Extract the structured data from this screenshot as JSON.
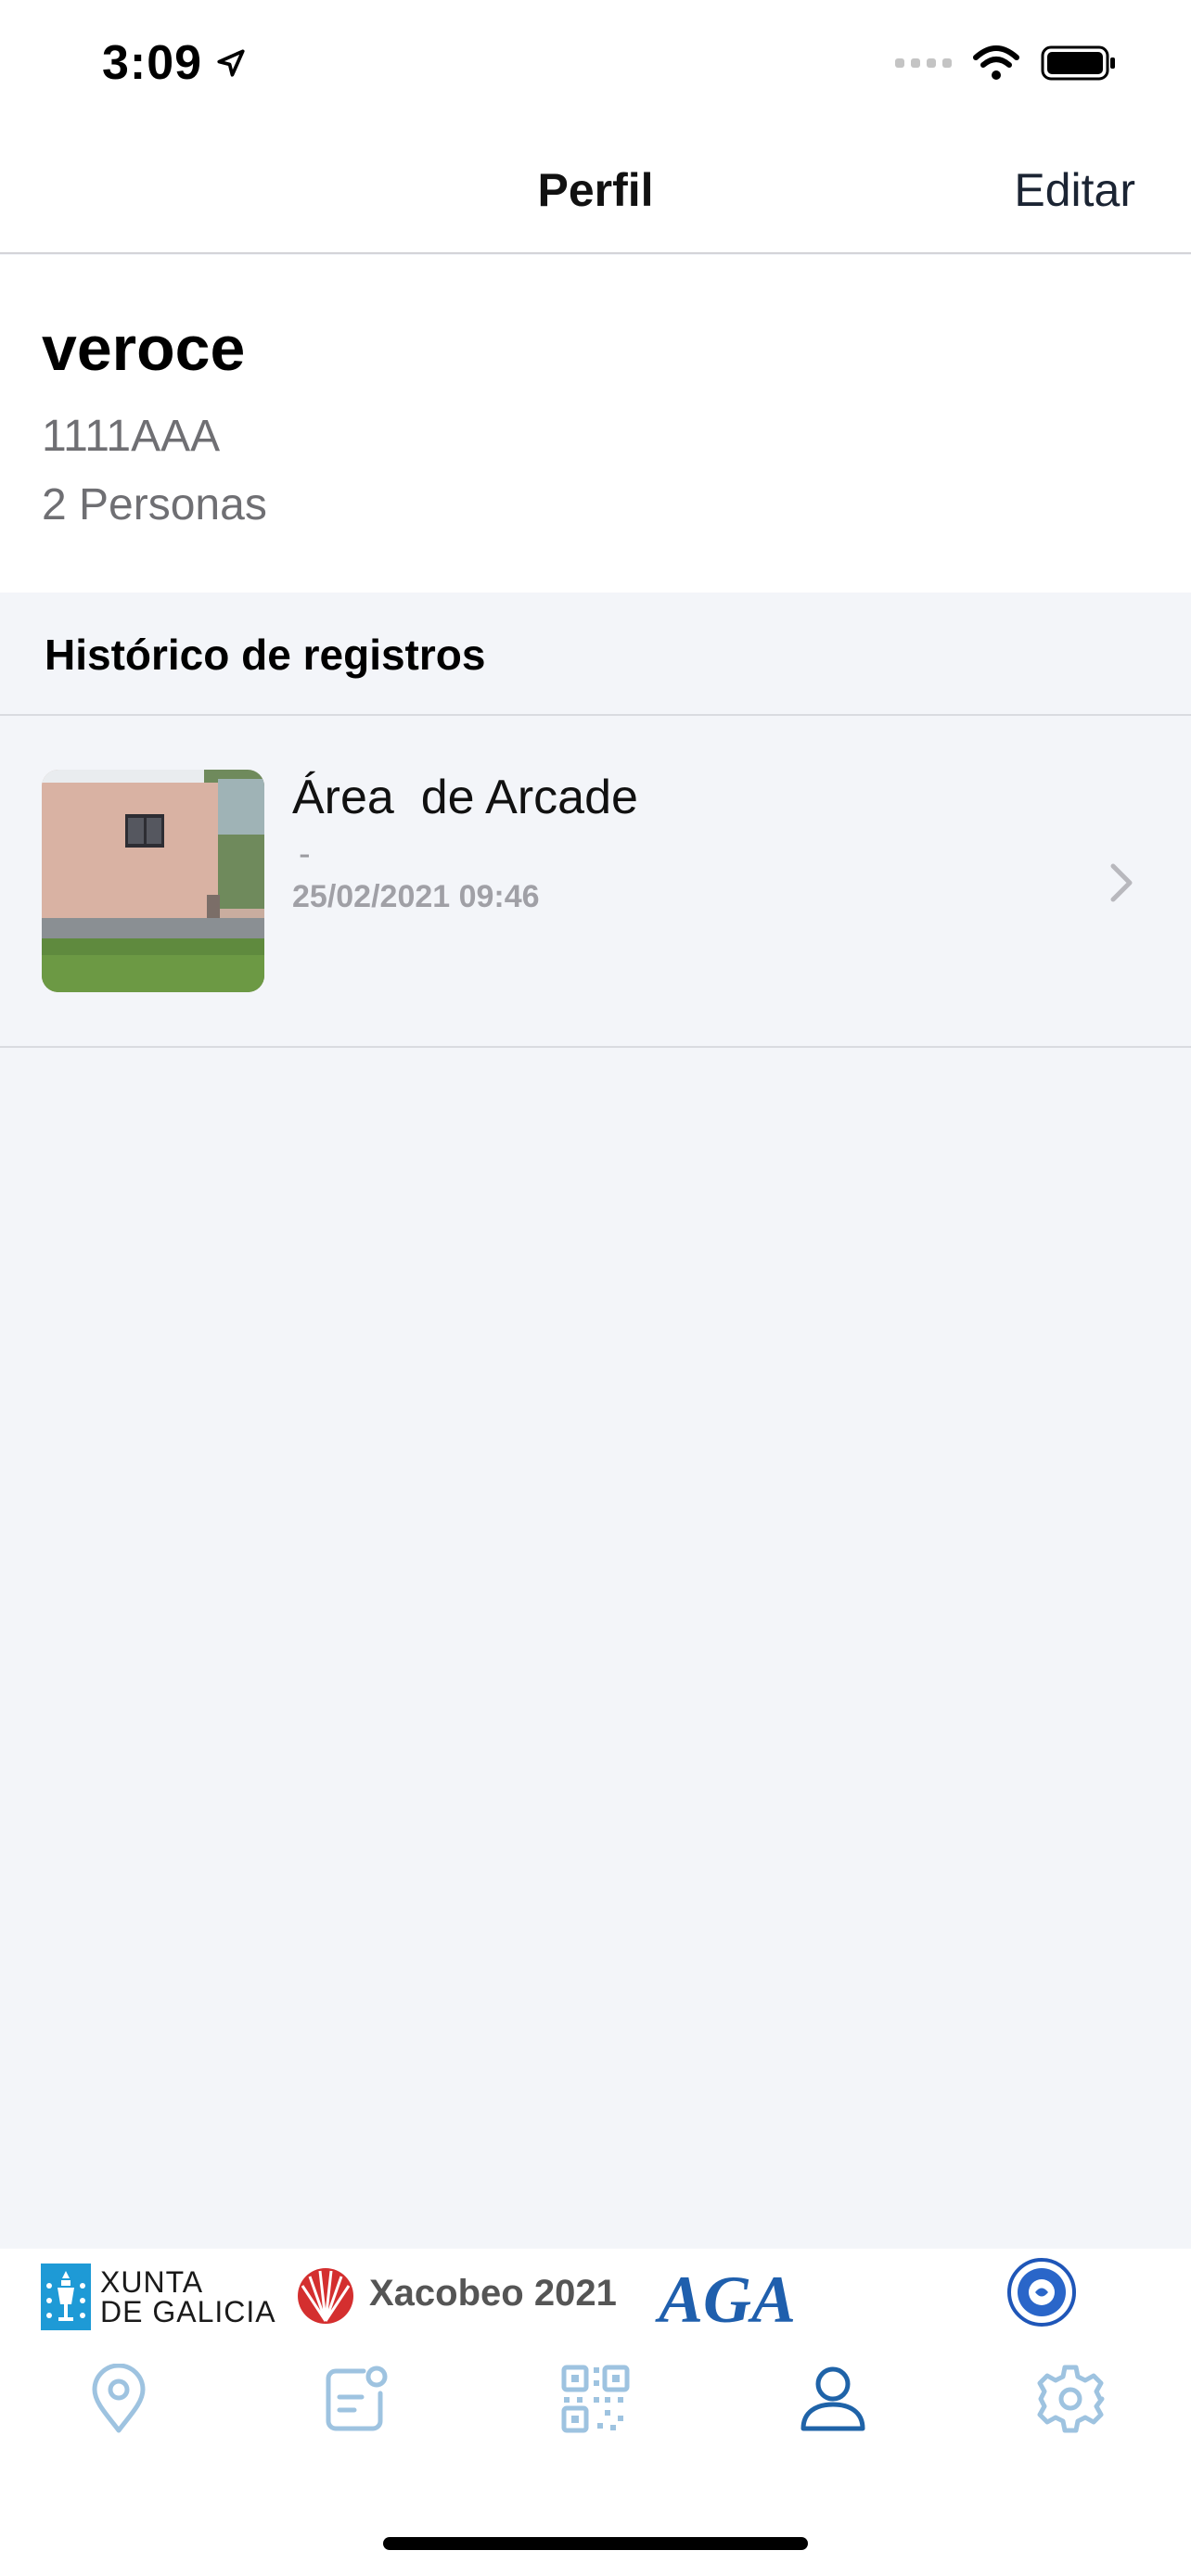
{
  "status_bar": {
    "time": "3:09"
  },
  "nav": {
    "title": "Perfil",
    "edit_label": "Editar"
  },
  "profile": {
    "name": "veroce",
    "plate": "1111AAA",
    "people": "2 Personas"
  },
  "history": {
    "section_title": "Histórico de registros",
    "records": [
      {
        "title": "Área  de Arcade",
        "subtitle": "-",
        "datetime": "25/02/2021 09:46"
      }
    ]
  },
  "sponsors": {
    "xunta_line1": "XUNTA",
    "xunta_line2": "DE GALICIA",
    "xacobeo": "Xacobeo 2021",
    "aga": "AGA"
  },
  "tabs": [
    {
      "icon": "location-pin-icon",
      "active": false
    },
    {
      "icon": "notes-icon",
      "active": false
    },
    {
      "icon": "qr-code-icon",
      "active": false
    },
    {
      "icon": "user-icon",
      "active": true
    },
    {
      "icon": "gear-icon",
      "active": false
    }
  ],
  "colors": {
    "tab_active": "#1f63a8",
    "tab_inactive": "#9ec3e0",
    "background": "#f3f5f9"
  }
}
